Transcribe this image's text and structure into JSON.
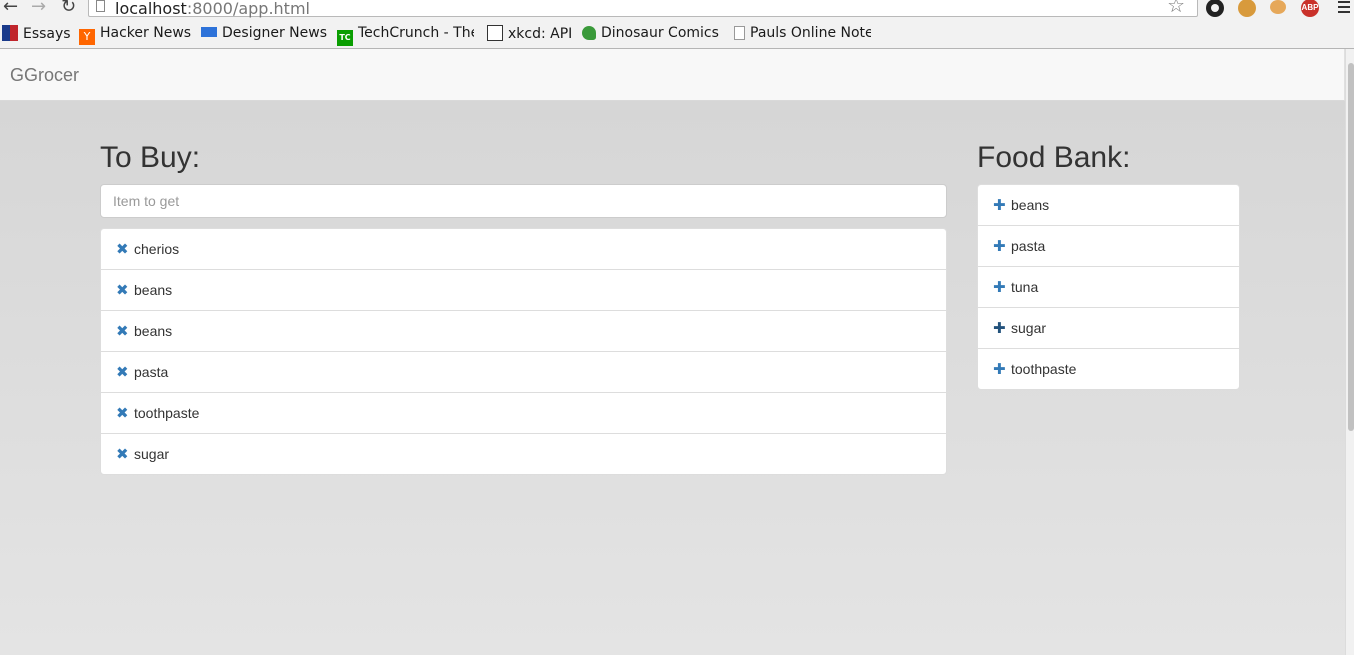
{
  "browser": {
    "url_host": "localhost",
    "url_path": ":8000/app.html",
    "bookmarks": [
      {
        "label": "Essays",
        "icon": "flag-icon",
        "color": "#1a3a8a"
      },
      {
        "label": "Hacker News",
        "icon": "y-icon",
        "color": "#ff6600"
      },
      {
        "label": "Designer News",
        "icon": "dn-icon",
        "color": "#2d72d9"
      },
      {
        "label": "TechCrunch - The",
        "icon": "tc-icon",
        "color": "#0a9e01"
      },
      {
        "label": "xkcd: API",
        "icon": "xkcd-icon",
        "color": "#333333"
      },
      {
        "label": "Dinosaur Comics",
        "icon": "dino-icon",
        "color": "#3a9a3a"
      },
      {
        "label": "Pauls Online Note",
        "icon": "page-icon",
        "color": "#888888"
      }
    ],
    "extensions": [
      "gear-icon",
      "cookie-icon",
      "cookie-icon",
      "adblock-icon"
    ],
    "abp_label": "ABP"
  },
  "app": {
    "brand": "GGrocer",
    "to_buy": {
      "title": "To Buy:",
      "input_placeholder": "Item to get",
      "input_value": "",
      "items": [
        "cherios",
        "beans",
        "beans",
        "pasta",
        "toothpaste",
        "sugar"
      ]
    },
    "food_bank": {
      "title": "Food Bank:",
      "items": [
        "beans",
        "pasta",
        "tuna",
        "sugar",
        "toothpaste"
      ]
    },
    "icons": {
      "remove": "✖",
      "add": "✚"
    },
    "accent_color": "#337ab7"
  }
}
